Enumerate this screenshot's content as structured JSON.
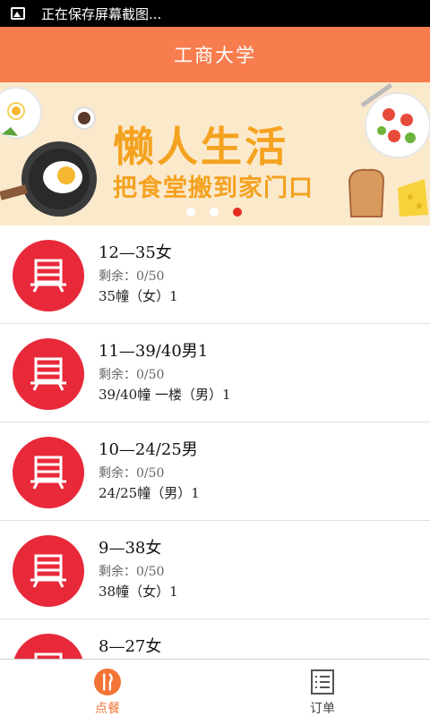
{
  "status_bar": {
    "text": "正在保存屏幕截图..."
  },
  "title_bar": {
    "title": "工商大学"
  },
  "banner": {
    "line1": "懒人生活",
    "line2": "把食堂搬到家门口",
    "active_dot": 3,
    "dot_count": 3
  },
  "list": {
    "items": [
      {
        "name": "12—35女",
        "remaining": "剩余：0/50",
        "address": "35幢（女）1"
      },
      {
        "name": "11—39/40男1",
        "remaining": "剩余：0/50",
        "address": "39/40幢 一楼（男）1"
      },
      {
        "name": "10—24/25男",
        "remaining": "剩余：0/50",
        "address": "24/25幢（男）1"
      },
      {
        "name": "9—38女",
        "remaining": "剩余：0/50",
        "address": "38幢（女）1"
      },
      {
        "name": "8—27女",
        "remaining": "",
        "address": ""
      }
    ]
  },
  "tab_bar": {
    "tabs": [
      {
        "label": "点餐",
        "icon": "utensils-icon",
        "active": true
      },
      {
        "label": "订单",
        "icon": "list-icon",
        "active": false
      }
    ]
  },
  "colors": {
    "accent": "#f77c4e",
    "logo_red": "#e8293a",
    "banner_text": "#f4a21f",
    "active_dot": "#e52b20"
  }
}
